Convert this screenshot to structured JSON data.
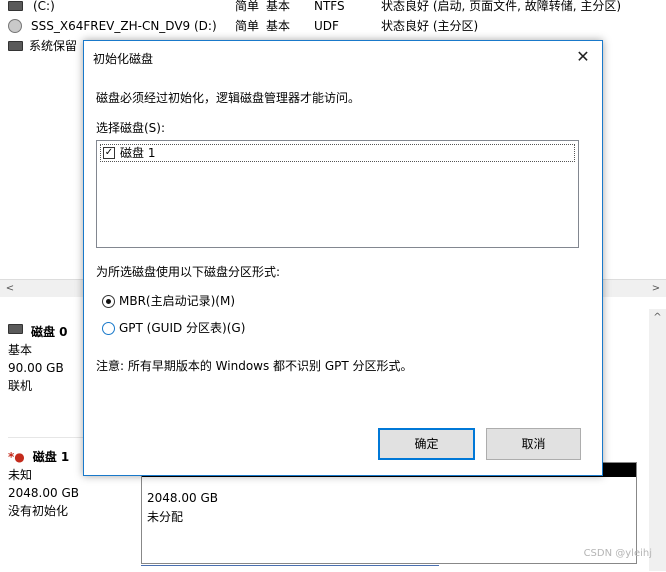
{
  "volumes": [
    {
      "name": "(C:)",
      "layout": "简单",
      "type": "基本",
      "fs": "NTFS",
      "status": "状态良好 (启动, 页面文件, 故障转储, 主分区)"
    },
    {
      "name": "SSS_X64FREV_ZH-CN_DV9 (D:)",
      "layout": "简单",
      "type": "基本",
      "fs": "UDF",
      "status": "状态良好 (主分区)"
    },
    {
      "name": "系统保留"
    }
  ],
  "disks": [
    {
      "name": "磁盘 0",
      "type": "基本",
      "size": "90.00 GB",
      "state": "联机"
    },
    {
      "name": "磁盘 1",
      "type": "未知",
      "size": "2048.00 GB",
      "state": "没有初始化"
    }
  ],
  "unallocated": {
    "size": "2048.00 GB",
    "label": "未分配"
  },
  "dialog": {
    "title": "初始化磁盘",
    "close_icon": "✕",
    "message": "磁盘必须经过初始化，逻辑磁盘管理器才能访问。",
    "select_label": "选择磁盘(S):",
    "disk_item": "磁盘 1",
    "partition_label": "为所选磁盘使用以下磁盘分区形式:",
    "mbr_label": "MBR(主启动记录)(M)",
    "gpt_label": "GPT (GUID 分区表)(G)",
    "note": "注意: 所有早期版本的 Windows 都不识别 GPT 分区形式。",
    "ok_label": "确定",
    "cancel_label": "取消"
  },
  "scroll": {
    "left": "<",
    "right": ">",
    "up": "^"
  },
  "watermark": "CSDN @yleihj"
}
